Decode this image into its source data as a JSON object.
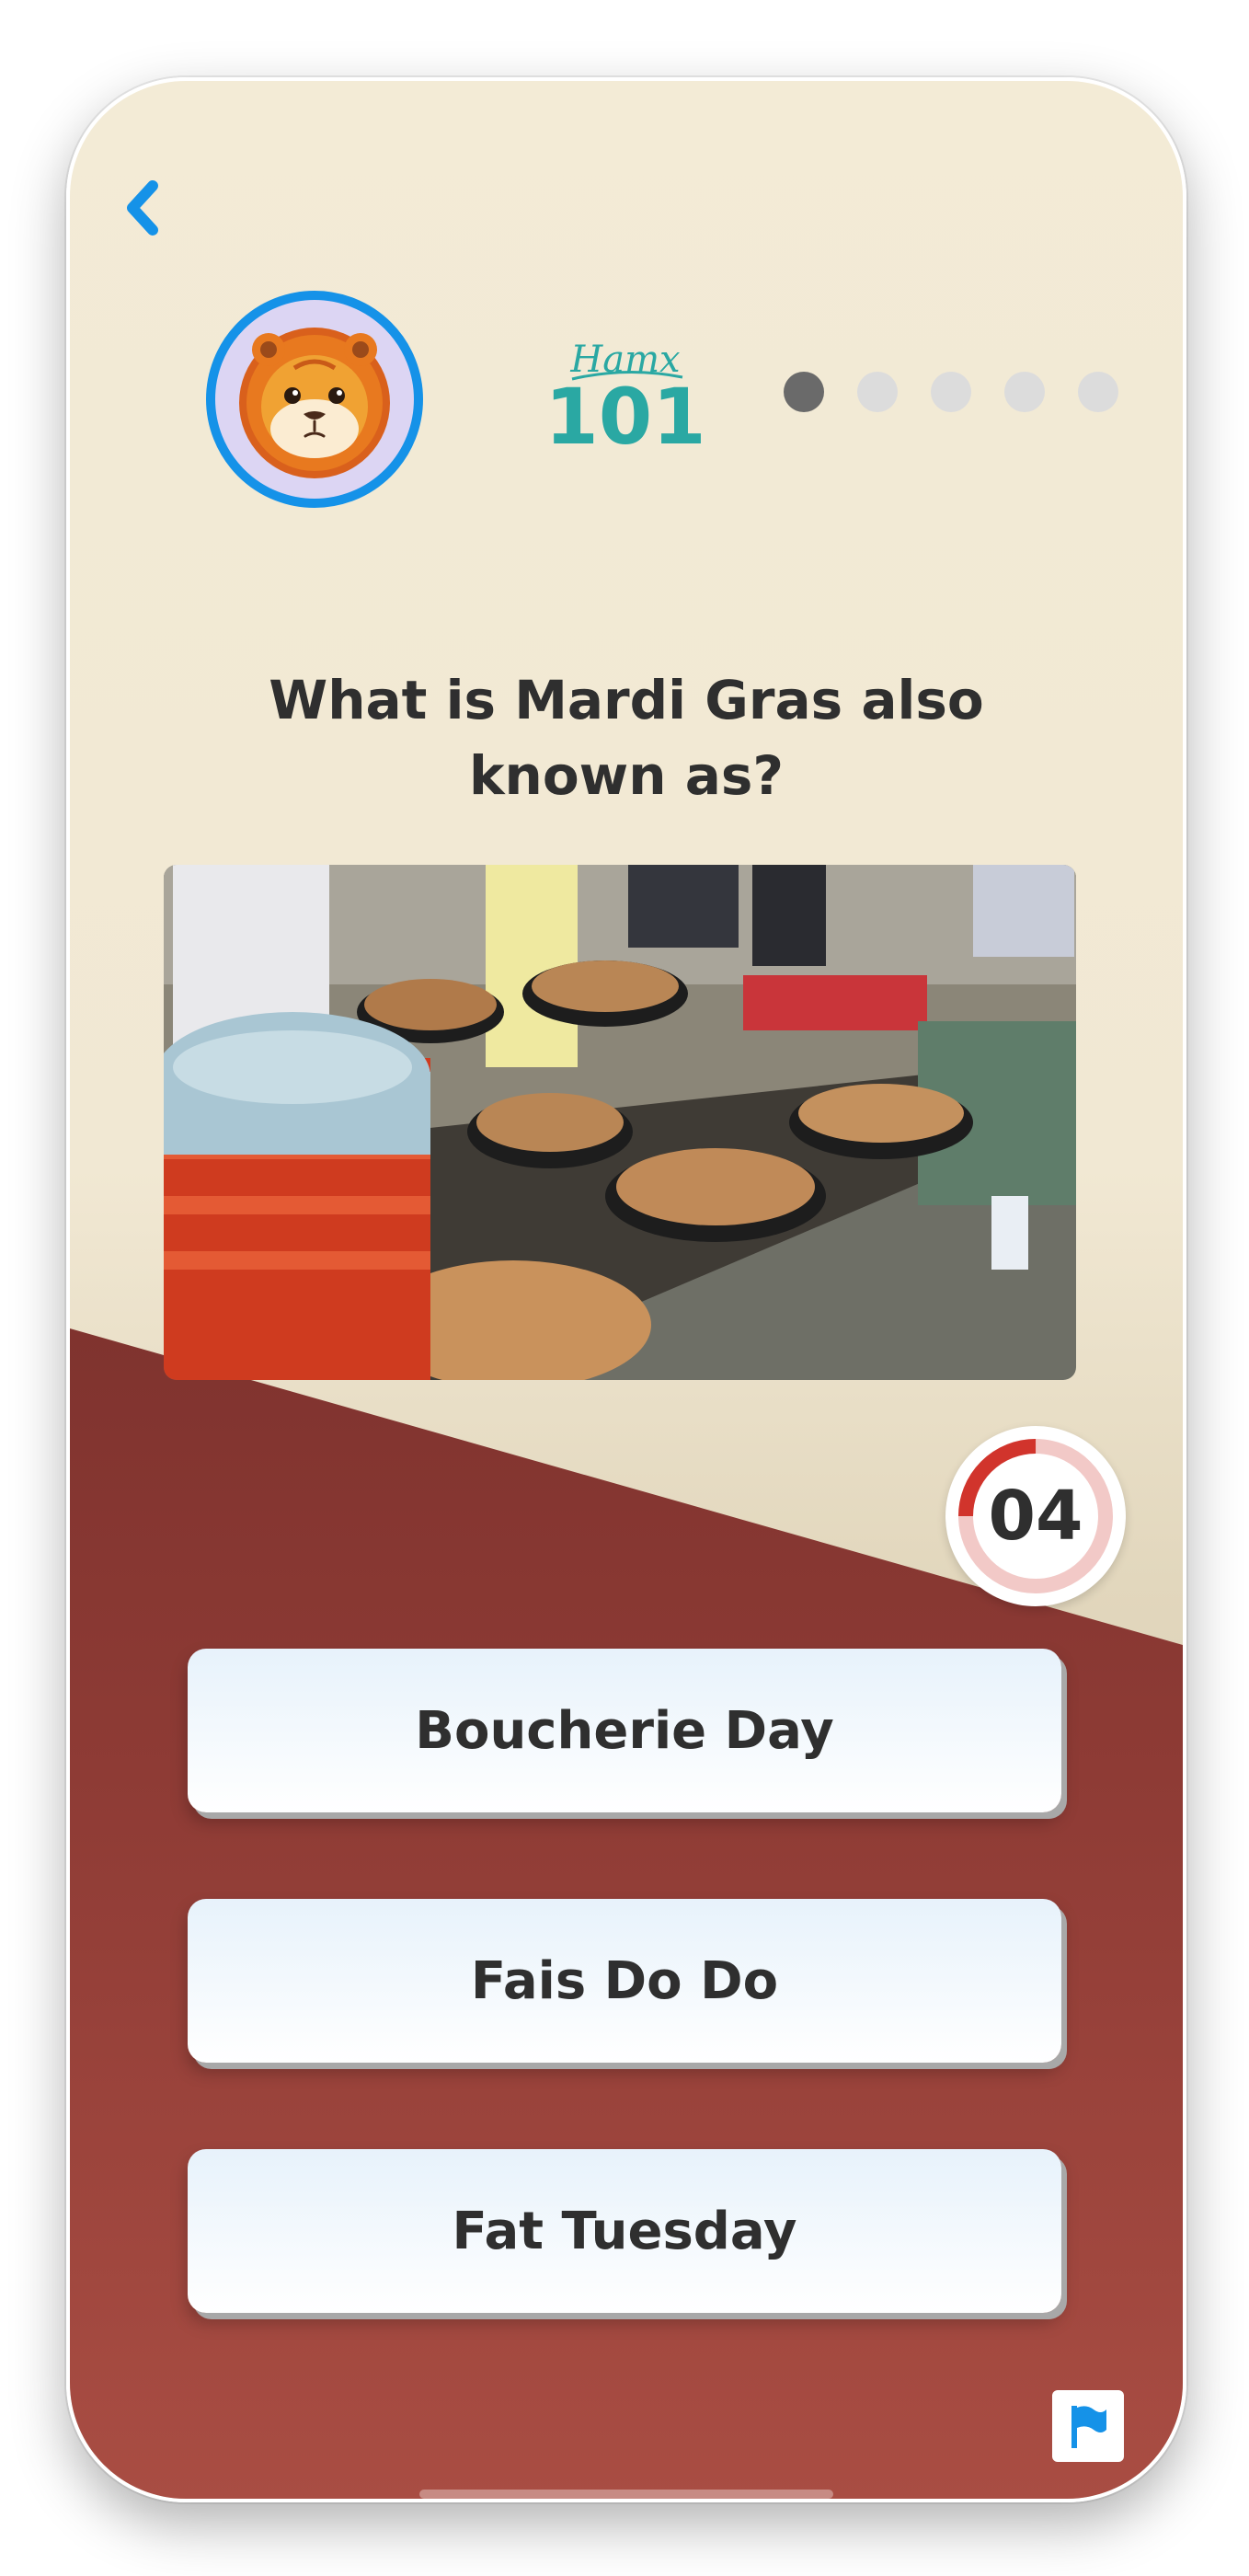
{
  "header": {
    "back_icon": "chevron-left-icon",
    "avatar_icon": "lion-face-icon",
    "logo_script": "Hamx",
    "logo_text": "101",
    "progress": {
      "total": 5,
      "current": 1
    }
  },
  "quiz": {
    "question": "What is Mardi Gras also known as?",
    "timer": "04",
    "timer_fraction_remaining": 0.25,
    "answers": [
      {
        "label": "Boucherie Day"
      },
      {
        "label": "Fais Do Do"
      },
      {
        "label": "Fat Tuesday"
      }
    ]
  },
  "footer": {
    "flag_icon": "report-flag-icon"
  },
  "colors": {
    "accent_blue": "#1592e8",
    "top_bg": "#f3ebd6",
    "bottom_bg": "#8e3b35",
    "timer_red": "#d1342c",
    "timer_track": "#f2c9c7",
    "logo_teal": "#2aa8a3"
  }
}
